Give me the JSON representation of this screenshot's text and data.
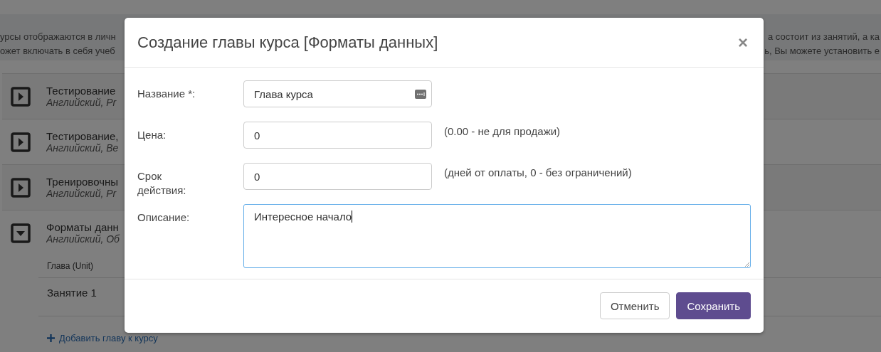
{
  "info": {
    "lines": [
      {
        "left": "урсы отображаются в личн",
        "right": "а состоит из занятий, а ка"
      },
      {
        "left": "ожет включать в себя учеб",
        "right": "ь, Вы можете установить е"
      }
    ]
  },
  "courses": [
    {
      "title": "Тестирование",
      "subtitle": "Английский, Pr",
      "expanded": false
    },
    {
      "title": "Тестирование,",
      "subtitle": "Английский, Ве",
      "expanded": false
    },
    {
      "title": "Тренировочны",
      "subtitle": "Английский, Pr",
      "expanded": false
    },
    {
      "title": "Форматы данн",
      "subtitle": "Английский, Об",
      "expanded": true,
      "column_header": "Глава (Unit)",
      "units": [
        "Занятие 1"
      ],
      "add_link": "Добавить главу к курсу"
    }
  ],
  "modal": {
    "title": "Создание главы курса [Форматы данных]",
    "close": "×",
    "fields": [
      {
        "kind": "text",
        "label": "Название *:",
        "value": "Глава курса",
        "menu_icon": true,
        "focused": false
      },
      {
        "kind": "text",
        "label": "Цена:",
        "value": "0",
        "hint": "(0.00 - не для продажи)",
        "focused": false
      },
      {
        "kind": "text",
        "label": "Срок действия:",
        "value": "0",
        "hint": "(дней от оплаты, 0 - без ограничений)",
        "focused": false
      },
      {
        "kind": "textarea",
        "label": "Описание:",
        "value": "Интересное начало",
        "focused": true
      }
    ],
    "buttons": [
      {
        "label": "Отменить",
        "kind": "secondary"
      },
      {
        "label": "Сохранить",
        "kind": "primary"
      }
    ]
  }
}
